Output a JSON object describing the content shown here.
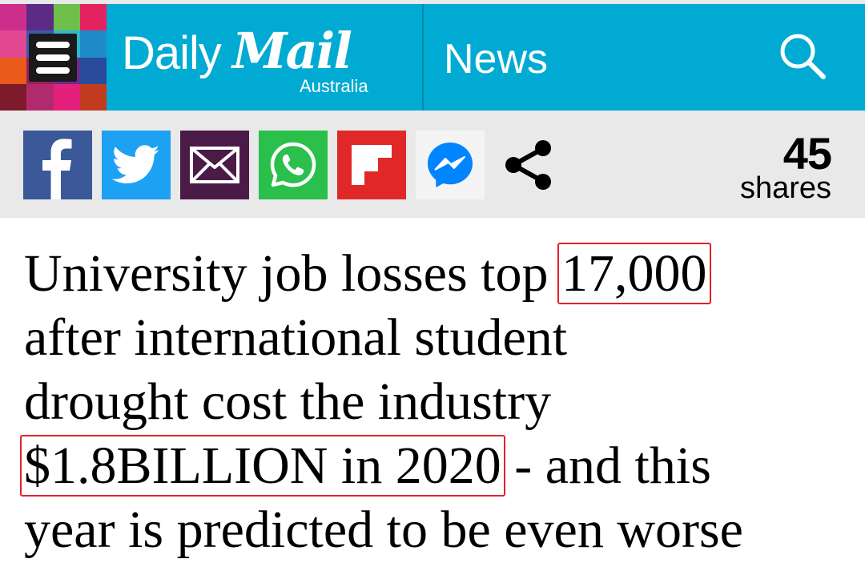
{
  "header": {
    "logo_primary": "Daily",
    "logo_secondary": "Mail",
    "logo_region": "Australia",
    "section": "News",
    "colors": {
      "background": "#00aad2",
      "text": "#ffffff"
    },
    "icons": {
      "menu": "hamburger-menu-icon",
      "search": "search-icon"
    }
  },
  "share_bar": {
    "buttons": [
      {
        "name": "facebook",
        "icon": "facebook-icon",
        "color": "#3b5998"
      },
      {
        "name": "twitter",
        "icon": "twitter-icon",
        "color": "#1da1f2"
      },
      {
        "name": "email",
        "icon": "email-icon",
        "color": "#4b1b47"
      },
      {
        "name": "whatsapp",
        "icon": "whatsapp-icon",
        "color": "#2bbf4c"
      },
      {
        "name": "flipboard",
        "icon": "flipboard-icon",
        "color": "#e12828"
      },
      {
        "name": "messenger",
        "icon": "messenger-icon",
        "color": "#0084ff"
      },
      {
        "name": "share",
        "icon": "share-icon",
        "color": "#000000"
      }
    ],
    "share_count": "45",
    "share_label": "shares"
  },
  "article": {
    "headline": {
      "l1_pre": "University job losses top ",
      "l1_box": "17,000",
      "l2": "after international student",
      "l3": "drought cost the industry",
      "l4_box": "$1.8BILLION in 2020",
      "l4_post": " - and this",
      "l5": "year is predicted to be even worse"
    },
    "highlight_color": "#e0222a"
  }
}
